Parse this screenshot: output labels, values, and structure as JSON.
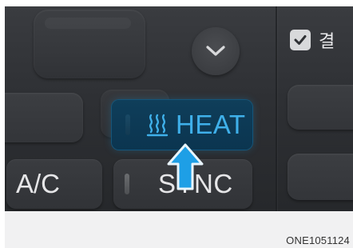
{
  "panel": {
    "checkbox": {
      "label": "결",
      "checked": true
    },
    "chevron_icon": "chevron-down-icon",
    "heat_button": {
      "label": "HEAT",
      "icon": "heat-waves-icon",
      "active": true,
      "active_color": "#3fb0ea"
    },
    "ac_button": {
      "label": "A/C"
    },
    "sync_button": {
      "label": "SYNC"
    },
    "pointer": {
      "icon": "up-arrow-pointer-icon",
      "color": "#1e9fe6"
    }
  },
  "footer": {
    "image_code": "ONE1051124"
  }
}
